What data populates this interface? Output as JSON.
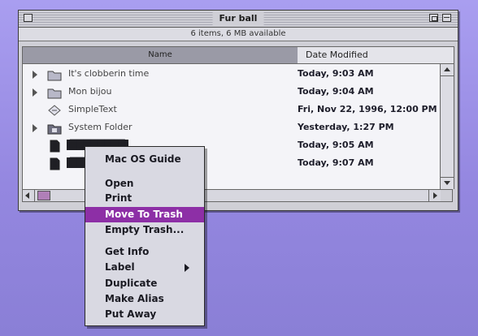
{
  "window": {
    "title": "Fur ball",
    "info": "6 items, 6 MB available",
    "columns": {
      "name": "Name",
      "date": "Date Modified"
    }
  },
  "files": [
    {
      "name": "It's clobberin time",
      "date": "Today, 9:03 AM",
      "icon": "folder-icon",
      "expandable": true
    },
    {
      "name": "Mon bijou",
      "date": "Today, 9:04 AM",
      "icon": "folder-icon",
      "expandable": true
    },
    {
      "name": "SimpleText",
      "date": "Fri, Nov 22, 1996, 12:00 PM",
      "icon": "application-icon",
      "expandable": false
    },
    {
      "name": "System Folder",
      "date": "Yesterday, 1:27 PM",
      "icon": "system-folder-icon",
      "expandable": true
    },
    {
      "name": "",
      "date": "Today, 9:05 AM",
      "icon": "document-icon",
      "expandable": false,
      "selected": true
    },
    {
      "name": "",
      "date": "Today, 9:07 AM",
      "icon": "document-icon",
      "expandable": false,
      "selected": true
    }
  ],
  "context_menu": {
    "items": [
      {
        "label": "Mac OS Guide",
        "highlighted": false
      },
      {
        "label": "Open",
        "highlighted": false
      },
      {
        "label": "Print",
        "highlighted": false
      },
      {
        "label": "Move To Trash",
        "highlighted": true
      },
      {
        "label": "Empty Trash...",
        "highlighted": false
      },
      {
        "label": "Get Info",
        "highlighted": false
      },
      {
        "label": "Label",
        "highlighted": false,
        "submenu": true
      },
      {
        "label": "Duplicate",
        "highlighted": false
      },
      {
        "label": "Make Alias",
        "highlighted": false
      },
      {
        "label": "Put Away",
        "highlighted": false
      }
    ]
  },
  "colors": {
    "desktop": "#9a8fe0",
    "menu_highlight": "#8d2fa6",
    "window_chrome": "#cfcfd6"
  }
}
